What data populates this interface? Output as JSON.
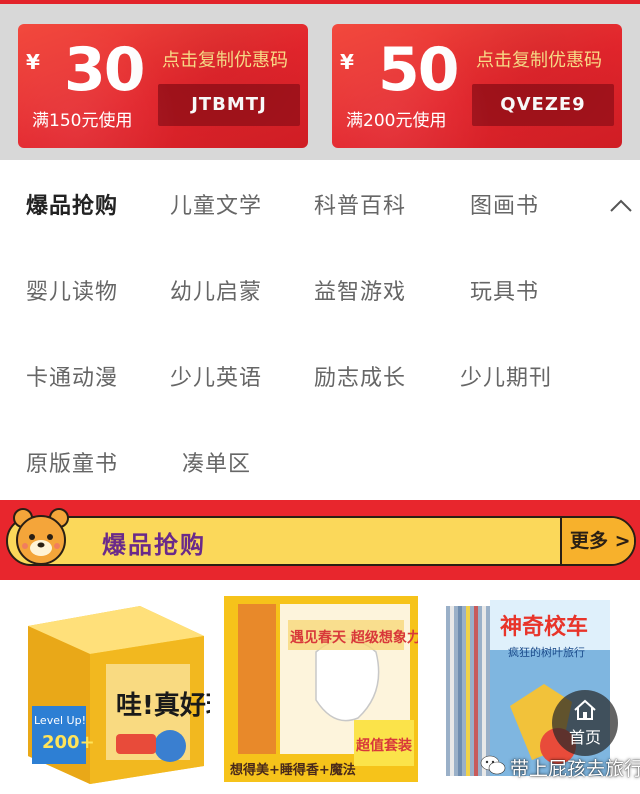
{
  "coupons": [
    {
      "currency": "¥",
      "amount": "30",
      "condition": "满150元使用",
      "copy_label": "点击复制优惠码",
      "code": "JTBMTJ"
    },
    {
      "currency": "¥",
      "amount": "50",
      "condition": "满200元使用",
      "copy_label": "点击复制优惠码",
      "code": "QVEZE9"
    }
  ],
  "categories": [
    "爆品抢购",
    "儿童文学",
    "科普百科",
    "图画书",
    "婴儿读物",
    "幼儿启蒙",
    "益智游戏",
    "玩具书",
    "卡通动漫",
    "少儿英语",
    "励志成长",
    "少儿期刊",
    "原版童书",
    "凑单区"
  ],
  "active_category": "爆品抢购",
  "banner": {
    "title": "爆品抢购",
    "more_label": "更多 >"
  },
  "products": [
    {
      "title": "哇!真好玩",
      "badge": "Level Up!",
      "badge_count": "200+"
    },
    {
      "title": "遇见春天 超级想象力图画书",
      "tagline": "想得美+睡得香+魔法",
      "promo": "超值套装"
    },
    {
      "title": "神奇校车",
      "subtitle": "疯狂的树叶旅行"
    }
  ],
  "home_button": {
    "label": "首页"
  },
  "watermark": "带上屁孩去旅行",
  "colors": {
    "brand_red": "#e8262d",
    "banner_yellow": "#fbd85a",
    "banner_text": "#6a2a8a",
    "coupon_code_bg": "#a3121b"
  }
}
